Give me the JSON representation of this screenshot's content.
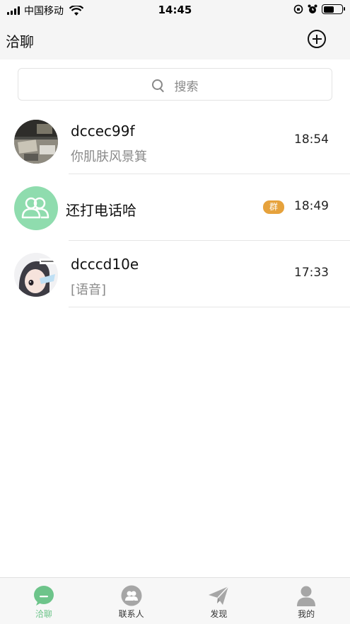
{
  "status_bar": {
    "carrier": "中国移动",
    "time": "14:45"
  },
  "nav": {
    "title": "洽聊"
  },
  "search": {
    "placeholder": "搜索"
  },
  "chats": [
    {
      "name": "dccec99f",
      "preview": "你肌肤风景箕",
      "time": "18:54"
    },
    {
      "name": "还打电话哈",
      "badge": "群",
      "time": "18:49"
    },
    {
      "name": "dcccd10e",
      "preview": "[语音]",
      "time": "17:33"
    }
  ],
  "tabs": [
    {
      "label": "洽聊",
      "icon": "chat-bubble-icon",
      "active": true
    },
    {
      "label": "联系人",
      "icon": "contacts-icon",
      "active": false
    },
    {
      "label": "发现",
      "icon": "paper-plane-icon",
      "active": false
    },
    {
      "label": "我的",
      "icon": "person-icon",
      "active": false
    }
  ],
  "colors": {
    "accent_green": "#6dc48a",
    "group_avatar": "#8fdcae",
    "badge_orange": "#e6a23c",
    "tab_inactive": "#a6a6a6"
  }
}
